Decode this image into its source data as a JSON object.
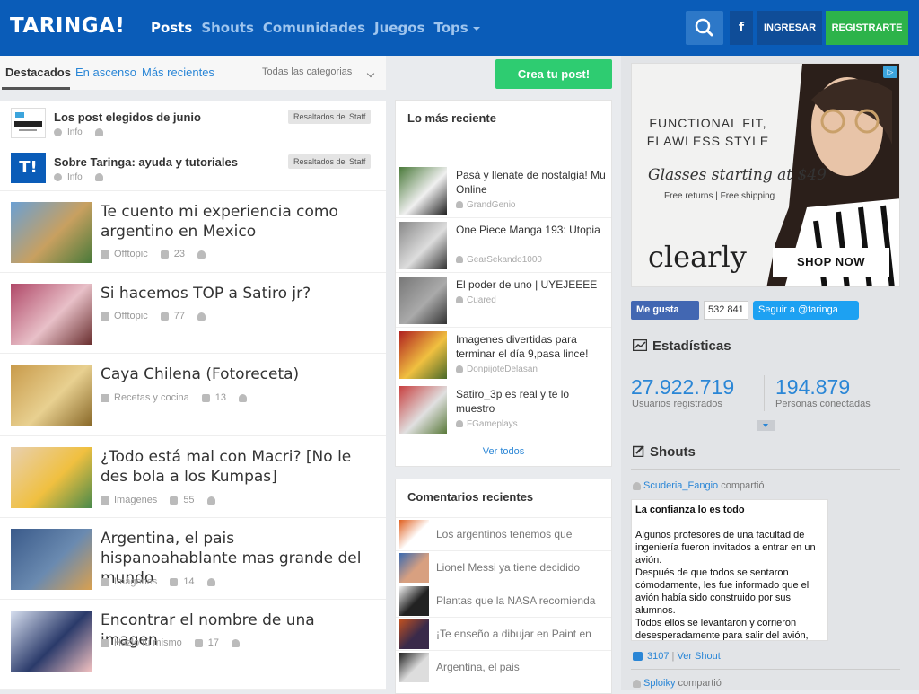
{
  "header": {
    "logo": "TARINGA!",
    "nav": [
      "Posts",
      "Shouts",
      "Comunidades",
      "Juegos",
      "Tops"
    ],
    "active_nav": "Posts",
    "facebook_label": "f",
    "login_label": "INGRESAR",
    "register_label": "REGISTRARTE"
  },
  "tabs": {
    "items": [
      "Destacados",
      "En ascenso",
      "Más recientes"
    ],
    "active": "Destacados",
    "category_select": "Todas las categorias",
    "create_post_label": "Crea tu post!"
  },
  "staff_posts": [
    {
      "title": "Los post elegidos de junio",
      "meta": "Info",
      "badge": "Resaltados del Staff",
      "thumb_icon": "taringa-logo-icon"
    },
    {
      "title": "Sobre Taringa: ayuda y tutoriales",
      "meta": "Info",
      "badge": "Resaltados del Staff",
      "thumb_icon": "taringa-t-logo-icon",
      "thumb_text": "T!"
    }
  ],
  "posts": [
    {
      "title": "Te cuento mi experiencia como argentino en Mexico",
      "category": "Offtopic",
      "comments": "23",
      "thumb_colors": [
        "#6aa0d4",
        "#c8a060",
        "#4a7a3a"
      ]
    },
    {
      "title": "Si hacemos TOP a Satiro jr?",
      "category": "Offtopic",
      "comments": "77",
      "thumb_colors": [
        "#b04868",
        "#e8c0c8",
        "#6a3030"
      ]
    },
    {
      "title": "Caya Chilena (Fotoreceta)",
      "category": "Recetas y cocina",
      "comments": "13",
      "thumb_colors": [
        "#c89a4a",
        "#e8d090",
        "#8a6a2a"
      ]
    },
    {
      "title": "¿Todo está mal con Macri? [No le des bola a los Kumpas]",
      "category": "Imágenes",
      "comments": "55",
      "thumb_colors": [
        "#e8d0b0",
        "#f0c040",
        "#4a8a4a"
      ]
    },
    {
      "title": "Argentina, el pais hispanoahablante mas grande del mundo",
      "category": "Imágenes",
      "comments": "14",
      "thumb_colors": [
        "#3a5a8a",
        "#6a8ab0",
        "#d8a050"
      ]
    },
    {
      "title": "Encontrar el nombre de una imagen",
      "category": "Hazlo tú mismo",
      "comments": "17",
      "thumb_colors": [
        "#d8e0f0",
        "#2a3a6a",
        "#f0c0c0"
      ]
    }
  ],
  "recent": {
    "title": "Lo más reciente",
    "items": [
      {
        "title": "Pasá y llenate de nostalgia! Mu Online",
        "author": "GrandGenio",
        "thumb_colors": [
          "#4a7a3a",
          "#f0f0f0",
          "#222"
        ]
      },
      {
        "title": "One Piece Manga 193: Utopia",
        "author": "GearSekando1000",
        "thumb_colors": [
          "#888",
          "#ddd",
          "#333"
        ]
      },
      {
        "title": "El poder de uno | UYEJEEEE",
        "author": "Cuared",
        "thumb_colors": [
          "#777",
          "#aaa",
          "#333"
        ]
      },
      {
        "title": "Imagenes divertidas para terminar el día 9,pasa lince!",
        "author": "DonpijoteDelasan",
        "thumb_colors": [
          "#b02020",
          "#f0c040",
          "#4a6a2a"
        ]
      },
      {
        "title": "Satiro_3p es real y te lo muestro",
        "author": "FGameplays",
        "thumb_colors": [
          "#c84040",
          "#e0e0e0",
          "#5a7a3a"
        ]
      }
    ],
    "see_all": "Ver todos"
  },
  "comments": {
    "title": "Comentarios recientes",
    "items": [
      {
        "text": "Los argentinos tenemos que",
        "avatar_colors": [
          "#e06020",
          "#ffffff"
        ]
      },
      {
        "text": "Lionel Messi ya tiene decidido",
        "avatar_colors": [
          "#3a6ab0",
          "#d8a080"
        ]
      },
      {
        "text": "Plantas que la NASA recomienda",
        "avatar_colors": [
          "#f0f0f0",
          "#222222"
        ]
      },
      {
        "text": "¡Te enseño a dibujar en Paint en",
        "avatar_colors": [
          "#c05020",
          "#3a2a4a"
        ]
      },
      {
        "text": "Argentina, el pais",
        "avatar_colors": [
          "#222222",
          "#dddddd"
        ]
      }
    ]
  },
  "ad": {
    "headline_1": "FUNCTIONAL FIT,",
    "headline_2": "FLAWLESS STYLE",
    "glasses_text": "Glasses starting at $49",
    "free_text": "Free returns  |  Free shipping",
    "brand": "clearly",
    "cta": "SHOP NOW"
  },
  "social": {
    "like_label": "Me gusta",
    "like_count": "532 841",
    "follow_label": "Seguir a @taringa"
  },
  "stats": {
    "title": "Estadísticas",
    "users_count": "27.922.719",
    "users_label": "Usuarios registrados",
    "online_count": "194.879",
    "online_label": "Personas conectadas"
  },
  "shouts": {
    "title": "Shouts",
    "items": [
      {
        "author": "Scuderia_Fangio",
        "action": "compartió"
      },
      {
        "author": "Sploiky",
        "action": "compartió"
      }
    ],
    "card_title": "La confianza lo es todo",
    "card_body": "Algunos profesores de una facultad de ingeniería fueron invitados a entrar en un avión.\nDespués de que todos se sentaron cómodamente, les fue informado que el avión había sido construido por sus alumnos.\nTodos ellos se levantaron y corrieron desesperadamente para salir del avión, excepto uno.",
    "likes": "3107",
    "see_shout": "Ver Shout"
  },
  "colors": {
    "brand_blue": "#0a5cb8",
    "register_green": "#2db34a",
    "create_green": "#2ecc71",
    "link_blue": "#2a86d6"
  }
}
